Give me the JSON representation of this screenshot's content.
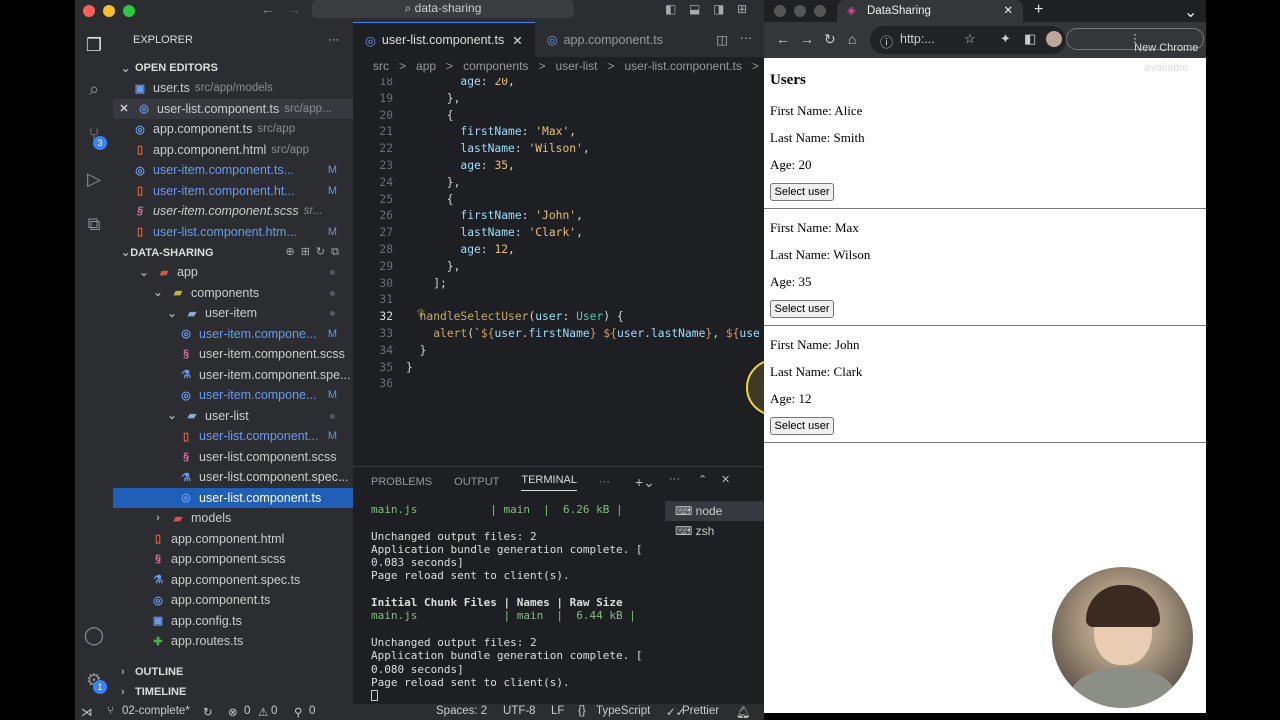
{
  "titlebar": {
    "search": "data-sharing"
  },
  "sidebar": {
    "title": "EXPLORER",
    "open_editors_label": "OPEN EDITORS",
    "open_editors": [
      {
        "name": "user.ts",
        "path": "src/app/models",
        "icon": "TS"
      },
      {
        "name": "user-list.component.ts",
        "path": "src/app...",
        "icon": "TS",
        "close": "✕"
      },
      {
        "name": "app.component.ts",
        "path": "src/app",
        "icon": "TS"
      },
      {
        "name": "app.component.html",
        "path": "src/app",
        "icon": "5"
      },
      {
        "name": "user-item.component.ts...",
        "badge": "M",
        "icon": "TS"
      },
      {
        "name": "user-item.component.ht...",
        "badge": "M",
        "icon": "5"
      },
      {
        "name": "user-item.component.scss",
        "path": "sr...",
        "icon": "S"
      },
      {
        "name": "user-list.component.htm...",
        "badge": "M",
        "icon": "5"
      }
    ],
    "project_label": "DATA-SHARING",
    "tree": [
      {
        "name": "app",
        "depth": 1
      },
      {
        "name": "components",
        "depth": 2
      },
      {
        "name": "user-item",
        "depth": 3
      },
      {
        "name": "user-item.compone...",
        "depth": 4,
        "badge": "M"
      },
      {
        "name": "user-item.component.scss",
        "depth": 4
      },
      {
        "name": "user-item.component.spe...",
        "depth": 4
      },
      {
        "name": "user-item.compone...",
        "depth": 4,
        "badge": "M"
      },
      {
        "name": "user-list",
        "depth": 3
      },
      {
        "name": "user-list.component...",
        "depth": 4,
        "badge": "M"
      },
      {
        "name": "user-list.component.scss",
        "depth": 4
      },
      {
        "name": "user-list.component.spec...",
        "depth": 4
      },
      {
        "name": "user-list.component.ts",
        "depth": 4
      },
      {
        "name": "models",
        "depth": 2
      },
      {
        "name": "app.component.html",
        "depth": 2
      },
      {
        "name": "app.component.scss",
        "depth": 2
      },
      {
        "name": "app.component.spec.ts",
        "depth": 2
      },
      {
        "name": "app.component.ts",
        "depth": 2
      },
      {
        "name": "app.config.ts",
        "depth": 2
      },
      {
        "name": "app.routes.ts",
        "depth": 2
      }
    ],
    "outline": "OUTLINE",
    "timeline": "TIMELINE"
  },
  "editor": {
    "tabs": [
      "user-list.component.ts",
      "app.component.ts"
    ],
    "breadcrumb": [
      "src",
      ">",
      "app",
      ">",
      "components",
      ">",
      "user-list",
      ">",
      "user-list.component.ts",
      ">"
    ],
    "lines": [
      "18",
      "19",
      "20",
      "21",
      "22",
      "23",
      "24",
      "25",
      "26",
      "27",
      "28",
      "29",
      "30",
      "31",
      "32",
      "33",
      "34",
      "35",
      "36"
    ]
  },
  "panel": {
    "tabs": [
      "PROBLEMS",
      "OUTPUT",
      "TERMINAL"
    ],
    "terminal": [
      "main.js           | main  |  6.26 kB |",
      "",
      "Unchanged output files: 2",
      "Application bundle generation complete. [",
      "0.083 seconds]",
      "Page reload sent to client(s).",
      "",
      "Initial Chunk Files | Names | Raw Size",
      "main.js             | main  |  6.44 kB |",
      "",
      "Unchanged output files: 2",
      "Application bundle generation complete. [",
      "0.080 seconds]",
      "Page reload sent to client(s)."
    ],
    "shells": [
      "node",
      "zsh"
    ]
  },
  "status": {
    "branch": "02-complete*",
    "errors": "0",
    "warnings": "0",
    "ports": "0",
    "spaces": "Spaces: 2",
    "encoding": "UTF-8",
    "eol": "LF",
    "lang": "TypeScript",
    "formatter": "Prettier"
  },
  "browser": {
    "tab_title": "DataSharing",
    "url": "http:...",
    "update_btn": "New Chrome available",
    "heading": "Users",
    "users": [
      {
        "first": "First Name: Alice",
        "last": "Last Name: Smith",
        "age": "Age: 20"
      },
      {
        "first": "First Name: Max",
        "last": "Last Name: Wilson",
        "age": "Age: 35"
      },
      {
        "first": "First Name: John",
        "last": "Last Name: Clark",
        "age": "Age: 12"
      }
    ],
    "button": "Select user"
  }
}
